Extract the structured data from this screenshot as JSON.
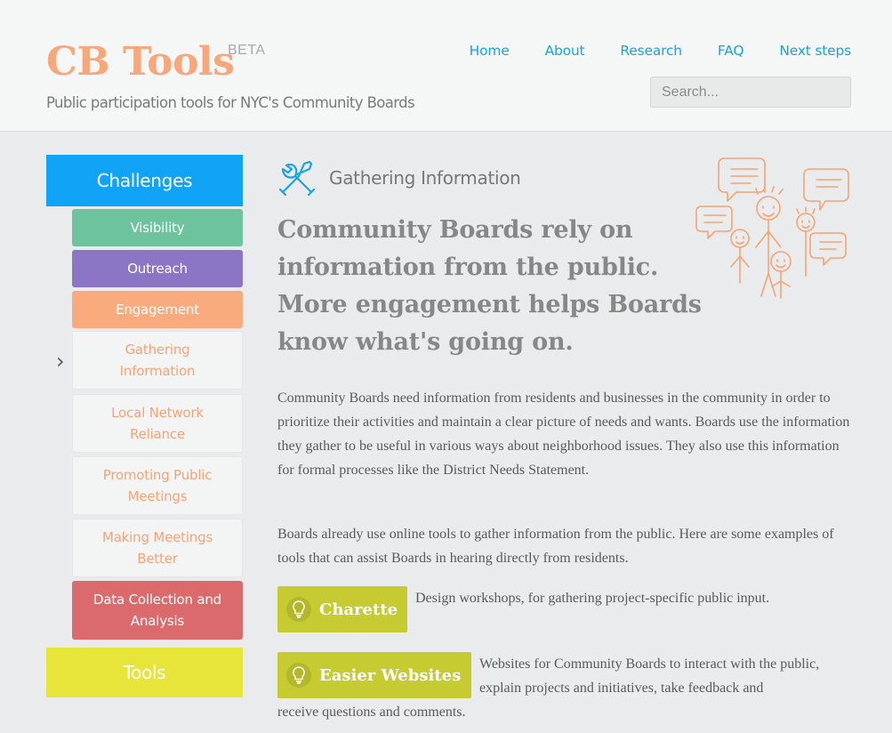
{
  "header": {
    "logo": "CB Tools",
    "beta": "BETA",
    "tagline": "Public participation tools for NYC's Community Boards",
    "nav": [
      "Home",
      "About",
      "Research",
      "FAQ",
      "Next steps"
    ],
    "search_placeholder": "Search..."
  },
  "sidebar": {
    "challenges_label": "Challenges",
    "items": [
      {
        "label": "Visibility"
      },
      {
        "label": "Outreach"
      },
      {
        "label": "Engagement"
      },
      {
        "label": "Gathering Information"
      },
      {
        "label": "Local Network Reliance"
      },
      {
        "label": "Promoting Public Meetings"
      },
      {
        "label": "Making Meetings Better"
      },
      {
        "label": "Data Collection and Analysis"
      }
    ],
    "tools_label": "Tools",
    "current_indicator": "›"
  },
  "main": {
    "section_title": "Gathering Information",
    "section_icon": "wrench-screwdriver-icon",
    "illustration_icon": "people-speech-bubbles-icon",
    "headline": "Community Boards rely on information from the public. More engagement helps Boards know what's going on.",
    "paragraph1": "Community Boards need information from residents and businesses in the community in order to prioritize their activities and maintain a clear picture of needs and wants. Boards use the information they gather to be useful in various ways about neighborhood issues. They also use this information for formal processes like the District Needs Statement.",
    "paragraph2": "Boards already use online tools to gather information from the public. Here are some examples of tools that can assist Boards in hearing directly from residents.",
    "tools": [
      {
        "label": "Charette",
        "description": "Design workshops, for gathering project-specific public input."
      },
      {
        "label": "Easier Websites",
        "description_line1": "Websites for Community Boards to interact with the public, explain projects and initiatives, take feedback and",
        "description_line2": "receive questions and comments."
      }
    ]
  },
  "colors": {
    "logo": "#f7a77a",
    "nav": "#1aa3e2",
    "challenges": "#11a3f5",
    "tools": "#e7e43a",
    "visibility": "#6cc39e",
    "outreach": "#8b75c5",
    "engagement": "#f9ab7e",
    "data_collection": "#da6a6b",
    "tool_button": "#c6cb32"
  }
}
